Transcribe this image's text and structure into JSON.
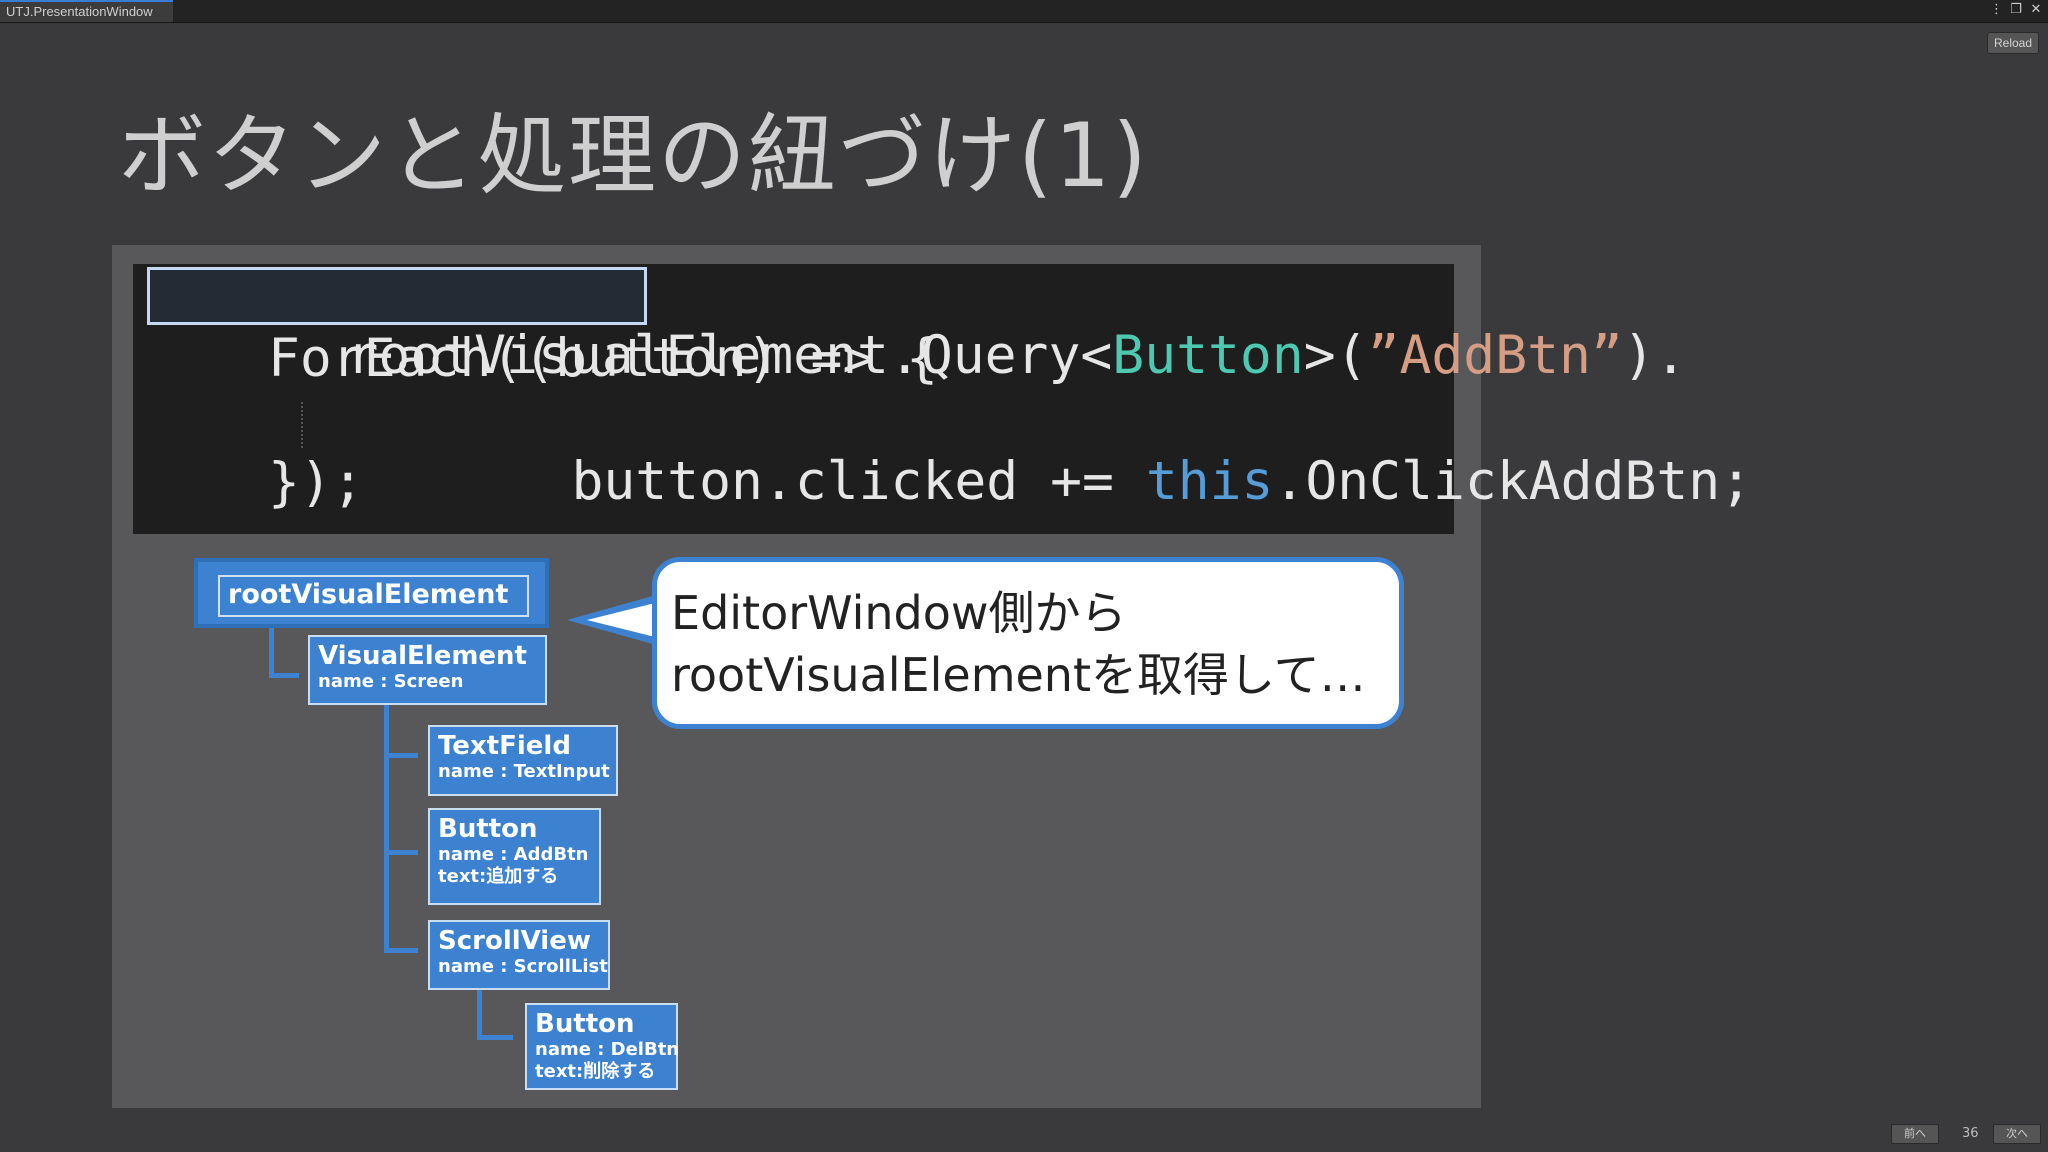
{
  "window": {
    "tab_title": "UTJ.PresentationWindow",
    "icons": [
      "more-icon",
      "maximize-icon",
      "close-icon"
    ],
    "reload_label": "Reload"
  },
  "slide": {
    "title": "ボタンと処理の紐づけ(1)",
    "code": {
      "line1": {
        "a": "rootVisualElement",
        "b": ".Query<",
        "c": "Button",
        "d": ">(",
        "e": "”AddBtn”",
        "f": ")."
      },
      "line2": "ForEach((button) => {",
      "line3": {
        "a": "button.clicked += ",
        "b": "this",
        "c": ".OnClickAddBtn;"
      },
      "line4": "});"
    },
    "tree": {
      "root": "rootVisualElement",
      "visual_element": {
        "type": "VisualElement",
        "name": "name : Screen"
      },
      "text_field": {
        "type": "TextField",
        "name": "name : TextInput"
      },
      "add_button": {
        "type": "Button",
        "name": "name : AddBtn",
        "text": "text:追加する"
      },
      "scroll_view": {
        "type": "ScrollView",
        "name": "name : ScrollList"
      },
      "del_button": {
        "type": "Button",
        "name": "name : DelBtn",
        "text": "text:削除する"
      }
    },
    "bubble": {
      "line1": "EditorWindow側から",
      "line2": "rootVisualElementを取得して…"
    }
  },
  "footer": {
    "prev_label": "前へ",
    "page_number": "36",
    "next_label": "次へ"
  },
  "colors": {
    "node_blue": "#3c82d0",
    "code_bg": "#1e1e1e",
    "keyword_blue": "#569cd6",
    "type_green": "#4ec9b0",
    "string_orange": "#d69d85"
  }
}
